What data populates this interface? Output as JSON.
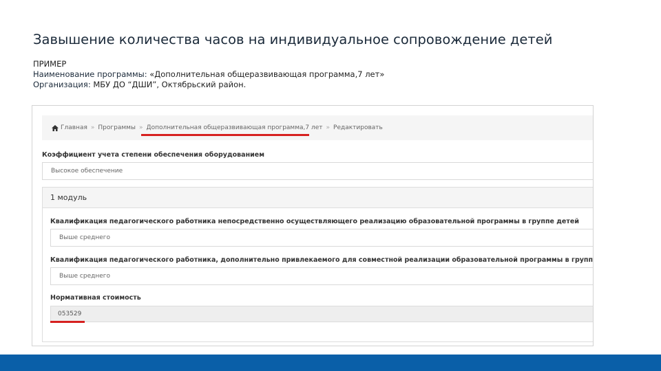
{
  "slide": {
    "title": "Завышение количества часов на индивидуальное сопровождение детей",
    "example": "ПРИМЕР",
    "program_label": "Наименование программы:",
    "program_value": " «Дополнительная общеразвивающая программа,7 лет»",
    "org_label": "Организация:",
    "org_value": " МБУ ДО “ДШИ”, Октябрьский район."
  },
  "breadcrumb": {
    "items": [
      "Главная",
      "Программы",
      "Дополнительная общеразвивающая программа,7 лет",
      "Редактировать"
    ],
    "separator": "»"
  },
  "form": {
    "equipment_label": "Коэффициент учета степени обеспечения оборудованием",
    "equipment_value": "Высокое обеспечение",
    "module_title": "1 модуль",
    "qual1_label": "Квалификация педагогического работника непосредственно осуществляющего реализацию образовательной программы в группе детей",
    "qual1_value": "Выше среднего",
    "qual2_label": "Квалификация педагогического работника, дополнительно привлекаемого для совместной реализации образовательной программы в группе",
    "qual2_value": "Выше среднего",
    "cost_label": "Нормативная стоимость",
    "cost_value": "053529"
  },
  "colors": {
    "accent_underline": "#d6201f",
    "footer_bar": "#0a5fa8"
  },
  "icons": {
    "home": "home-icon"
  }
}
